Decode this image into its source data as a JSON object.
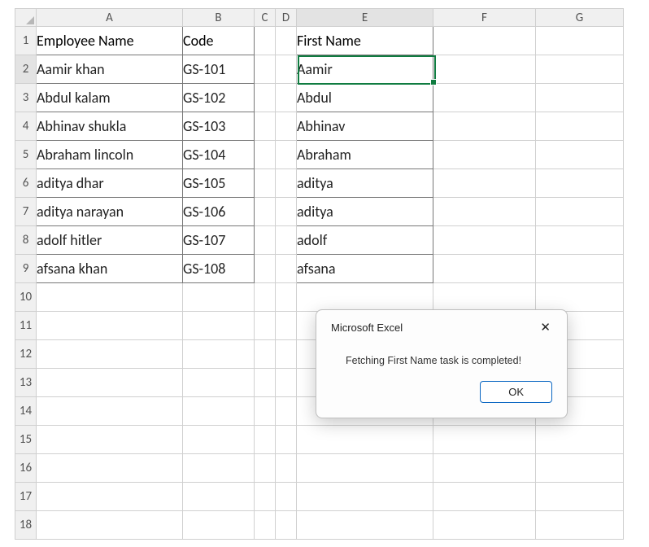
{
  "columns": [
    "A",
    "B",
    "C",
    "D",
    "E",
    "F",
    "G"
  ],
  "row_count": 18,
  "active_cell": "E2",
  "headers": {
    "A1": "Employee Name",
    "B1": "Code",
    "E1": "First Name"
  },
  "data": {
    "employees": [
      {
        "name": "Aamir khan",
        "code": "GS-101",
        "first": "Aamir"
      },
      {
        "name": "Abdul kalam",
        "code": "GS-102",
        "first": "Abdul"
      },
      {
        "name": "Abhinav shukla",
        "code": "GS-103",
        "first": "Abhinav"
      },
      {
        "name": "Abraham lincoln",
        "code": "GS-104",
        "first": "Abraham"
      },
      {
        "name": "aditya dhar",
        "code": "GS-105",
        "first": "aditya"
      },
      {
        "name": "aditya narayan",
        "code": "GS-106",
        "first": "aditya"
      },
      {
        "name": "adolf hitler",
        "code": "GS-107",
        "first": "adolf"
      },
      {
        "name": "afsana khan",
        "code": "GS-108",
        "first": "afsana"
      }
    ]
  },
  "dialog": {
    "title": "Microsoft Excel",
    "message": "Fetching First Name task is completed!",
    "ok_label": "OK"
  }
}
